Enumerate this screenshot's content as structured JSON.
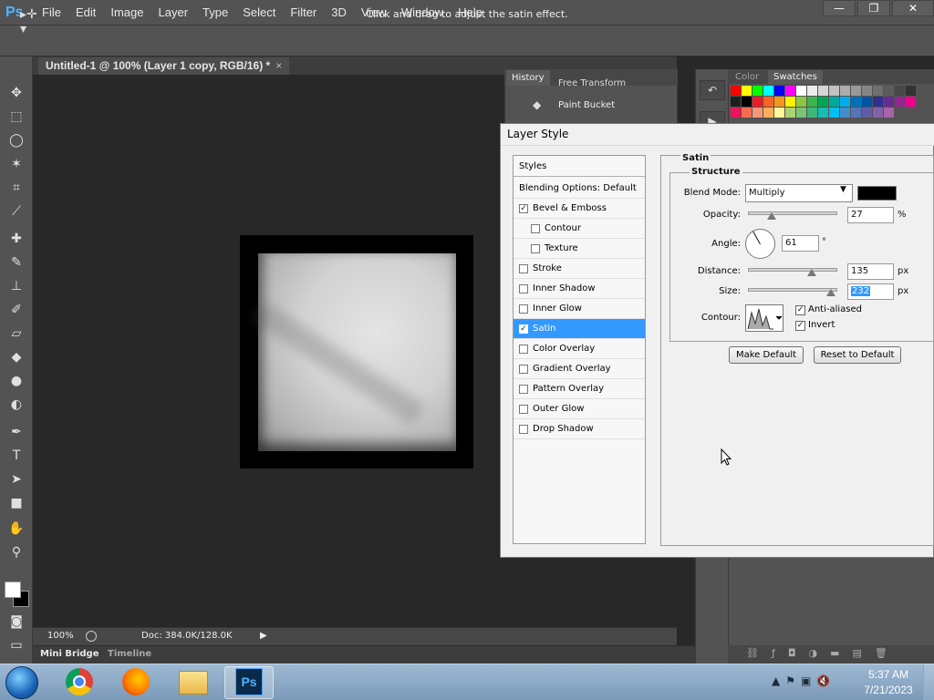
{
  "app": {
    "logo": "Ps"
  },
  "menu": [
    "File",
    "Edit",
    "Image",
    "Layer",
    "Type",
    "Select",
    "Filter",
    "3D",
    "View",
    "Window",
    "Help"
  ],
  "window_controls": {
    "minimize": "—",
    "restore": "❐",
    "close": "✕"
  },
  "options_bar": {
    "hint": "Click and drag to adjust the satin effect."
  },
  "document": {
    "tab_title": "Untitled-1 @ 100% (Layer 1 copy, RGB/16) *",
    "tab_close": "×"
  },
  "status": {
    "zoom": "100%",
    "doc_size": "Doc: 384.0K/128.0K"
  },
  "bottom_tabs": {
    "mini_bridge": "Mini Bridge",
    "timeline": "Timeline"
  },
  "history": {
    "tab": "History",
    "prev_item": "Free Transform",
    "item": "Paint Bucket"
  },
  "swatch_panel": {
    "color_tab": "Color",
    "swatches_tab": "Swatches",
    "colors": [
      "#ff0000",
      "#ffff00",
      "#00ff00",
      "#00ffff",
      "#0000ff",
      "#ff00ff",
      "#ffffff",
      "#ebebeb",
      "#d6d6d6",
      "#c2c2c2",
      "#adadad",
      "#999999",
      "#858585",
      "#707070",
      "#5c5c5c",
      "#474747",
      "#333333",
      "#1f1f1f",
      "#000000",
      "#ed1c24",
      "#f26522",
      "#f7941d",
      "#fff200",
      "#8dc63f",
      "#39b54a",
      "#00a651",
      "#00a99d",
      "#00aeef",
      "#0072bc",
      "#0054a6",
      "#2e3192",
      "#662d91",
      "#92278f",
      "#ec008c",
      "#ed145b",
      "#f26c4f",
      "#f69679",
      "#fbaf5d",
      "#fff799",
      "#acd373",
      "#7cc576",
      "#3cb878",
      "#1abbb4",
      "#00bff3",
      "#448ccb",
      "#5674b9",
      "#605ca8",
      "#8560a8",
      "#a864a8"
    ]
  },
  "dialog": {
    "title": "Layer Style",
    "styles_header": "Styles",
    "blending_options": "Blending Options: Default",
    "styles": [
      {
        "label": "Bevel & Emboss",
        "checked": "✓",
        "indent": false,
        "selected": false
      },
      {
        "label": "Contour",
        "checked": "",
        "indent": true,
        "selected": false
      },
      {
        "label": "Texture",
        "checked": "",
        "indent": true,
        "selected": false
      },
      {
        "label": "Stroke",
        "checked": "",
        "indent": false,
        "selected": false
      },
      {
        "label": "Inner Shadow",
        "checked": "",
        "indent": false,
        "selected": false
      },
      {
        "label": "Inner Glow",
        "checked": "",
        "indent": false,
        "selected": false
      },
      {
        "label": "Satin",
        "checked": "✓",
        "indent": false,
        "selected": true
      },
      {
        "label": "Color Overlay",
        "checked": "",
        "indent": false,
        "selected": false
      },
      {
        "label": "Gradient Overlay",
        "checked": "",
        "indent": false,
        "selected": false
      },
      {
        "label": "Pattern Overlay",
        "checked": "",
        "indent": false,
        "selected": false
      },
      {
        "label": "Outer Glow",
        "checked": "",
        "indent": false,
        "selected": false
      },
      {
        "label": "Drop Shadow",
        "checked": "",
        "indent": false,
        "selected": false
      }
    ],
    "section_title": "Satin",
    "group_title": "Structure",
    "blend_mode_label": "Blend Mode:",
    "blend_mode_value": "Multiply",
    "satin_color": "#000000",
    "opacity_label": "Opacity:",
    "opacity_value": "27",
    "opacity_unit": "%",
    "angle_label": "Angle:",
    "angle_value": "61",
    "angle_unit": "°",
    "distance_label": "Distance:",
    "distance_value": "135",
    "distance_unit": "px",
    "size_label": "Size:",
    "size_value": "232",
    "size_unit": "px",
    "contour_label": "Contour:",
    "anti_aliased_label": "Anti-aliased",
    "anti_aliased_checked": "✓",
    "invert_label": "Invert",
    "invert_checked": "✓",
    "make_default": "Make Default",
    "reset_default": "Reset to Default"
  },
  "taskbar": {
    "ps_label": "Ps",
    "time": "5:37 AM",
    "date": "7/21/2023"
  }
}
